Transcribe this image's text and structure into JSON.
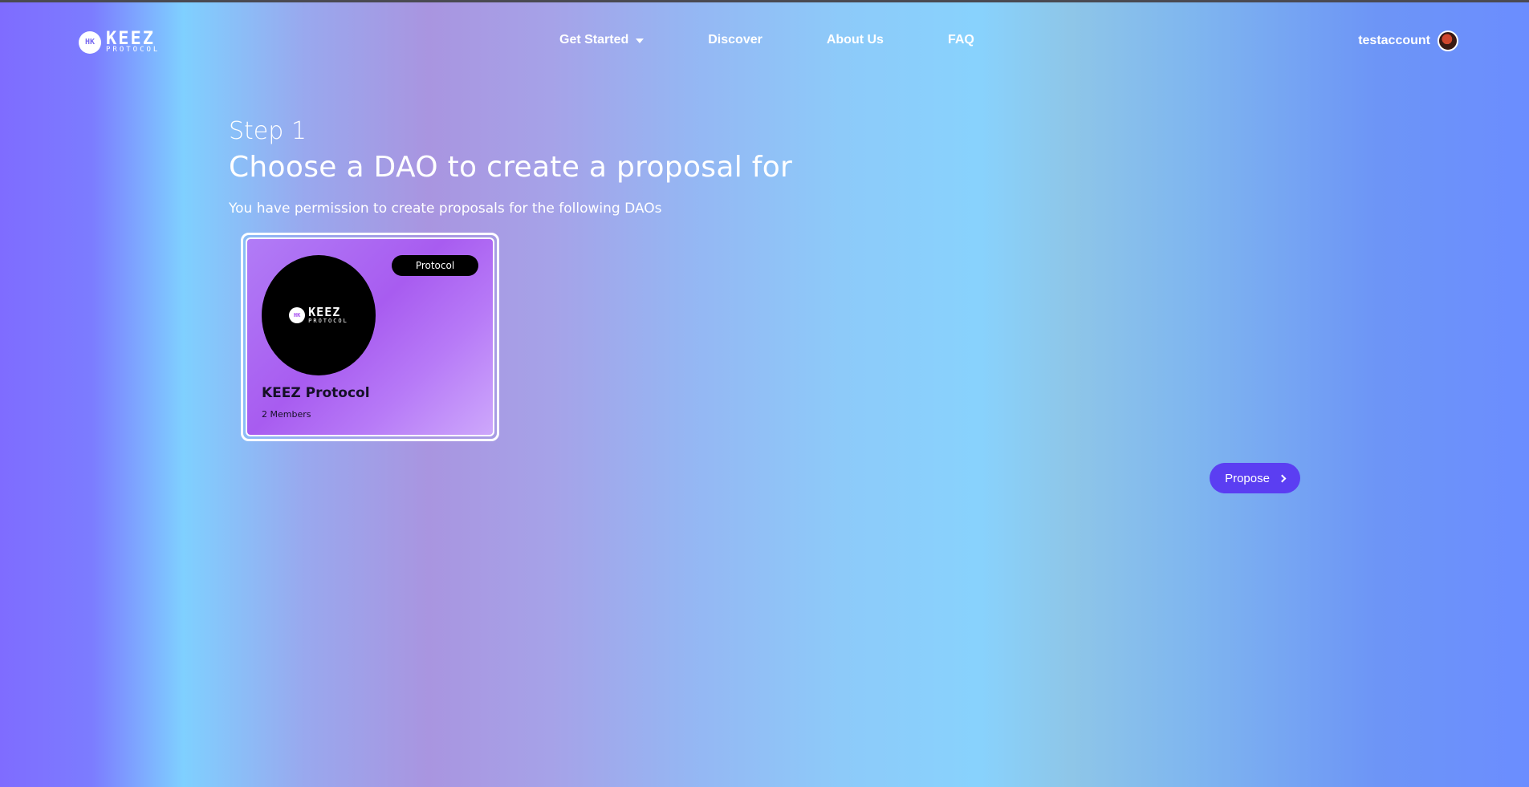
{
  "header": {
    "logo": {
      "badge_text": "HK",
      "wordmark": "KEEZ",
      "sub": "PROTOCOL"
    },
    "nav": [
      {
        "label": "Get Started",
        "has_dropdown": true
      },
      {
        "label": "Discover"
      },
      {
        "label": "About Us"
      },
      {
        "label": "FAQ"
      }
    ],
    "account": {
      "username": "testaccount"
    }
  },
  "main": {
    "step": "Step 1",
    "title": "Choose a DAO to create a proposal for",
    "subtitle": "You have permission to create proposals for the following DAOs",
    "daos": [
      {
        "badge": "Protocol",
        "logo_badge": "HK",
        "logo_wordmark": "KEEZ",
        "logo_sub": "PROTOCOL",
        "name": "KEEZ Protocol",
        "members": "2 Members"
      }
    ],
    "propose_label": "Propose"
  },
  "colors": {
    "accent": "#5b3ef2",
    "card_purple": "#a85cf0",
    "badge_black": "#000000",
    "text_dark": "#151026"
  },
  "icons": {
    "logo": "keez-logo-icon",
    "dropdown": "caret-down-icon",
    "propose": "chevron-right-icon"
  }
}
